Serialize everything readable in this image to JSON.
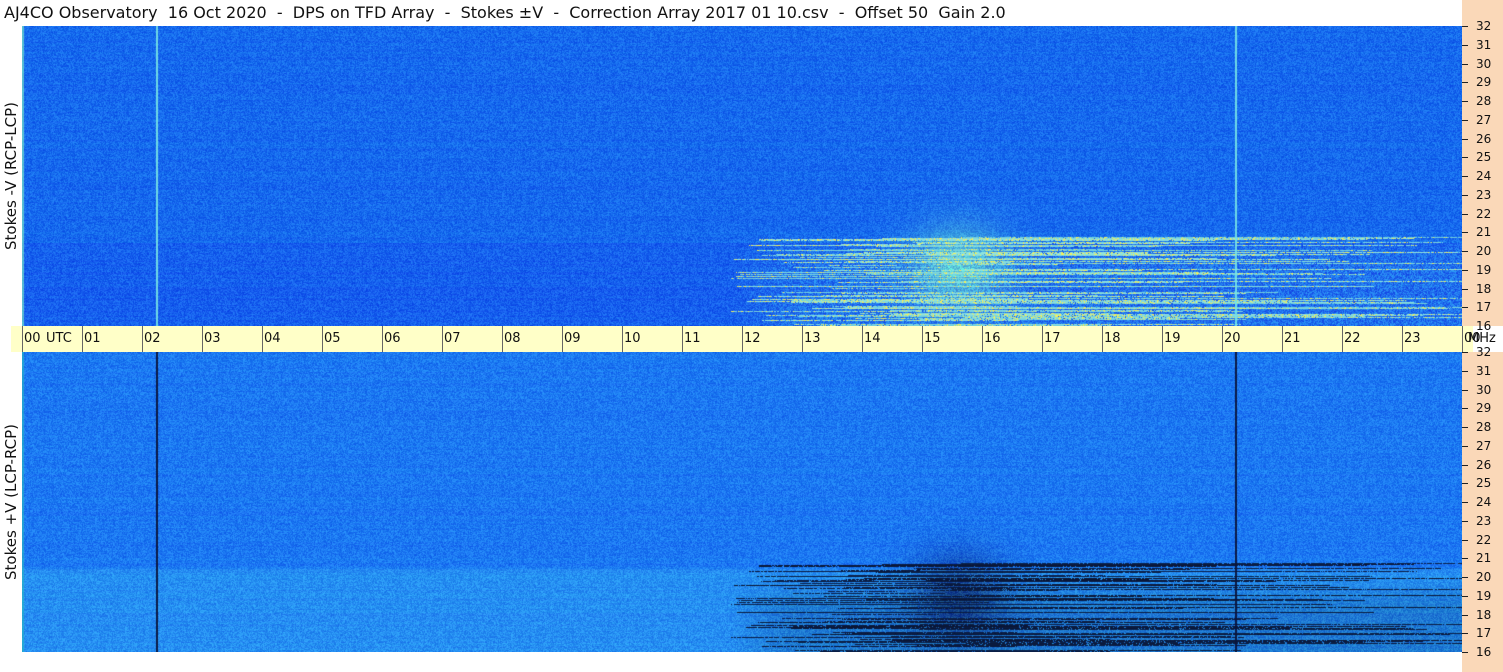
{
  "title": "AJ4CO Observatory  16 Oct 2020  -  DPS on TFD Array  -  Stokes ±V  -  Correction Array 2017 01 10.csv  -  Offset 50  Gain 2.0",
  "panels": [
    {
      "ylabel": "Stokes -V (RCP-LCP)"
    },
    {
      "ylabel": "Stokes +V (LCP-RCP)"
    }
  ],
  "time_labels": [
    "00",
    "01",
    "02",
    "03",
    "04",
    "05",
    "06",
    "07",
    "08",
    "09",
    "10",
    "11",
    "12",
    "13",
    "14",
    "15",
    "16",
    "17",
    "18",
    "19",
    "20",
    "21",
    "22",
    "23",
    "00"
  ],
  "time_unit": "UTC",
  "freq_unit": "MHz",
  "freq_labels": [
    "32",
    "31",
    "30",
    "29",
    "28",
    "27",
    "26",
    "25",
    "24",
    "23",
    "22",
    "21",
    "20",
    "19",
    "18",
    "17",
    "16"
  ],
  "colors": {
    "background": "#1a6cf0",
    "time_bar": "#ffffc8",
    "freq_bar": "#fad8b8",
    "storm_hot": "#f5f060"
  },
  "chart_data": {
    "type": "heatmap",
    "x_axis": {
      "range": [
        "00",
        "00"
      ],
      "ticks": [
        "00",
        "01",
        "02",
        "03",
        "04",
        "05",
        "06",
        "07",
        "08",
        "09",
        "10",
        "11",
        "12",
        "13",
        "14",
        "15",
        "16",
        "17",
        "18",
        "19",
        "20",
        "21",
        "22",
        "23",
        "00"
      ],
      "unit": "UTC"
    },
    "y_axis": {
      "range": [
        16,
        32
      ],
      "ticks": [
        16,
        17,
        18,
        19,
        20,
        21,
        22,
        23,
        24,
        25,
        26,
        27,
        28,
        29,
        30,
        31,
        32
      ],
      "unit": "MHz"
    },
    "panels": [
      "Stokes -V (RCP-LCP)",
      "Stokes +V (LCP-RCP)"
    ],
    "features": [
      {
        "panel": 0,
        "kind": "bright_vertical_line",
        "time_hour": 2.23
      },
      {
        "panel": 0,
        "kind": "bright_vertical_line",
        "time_hour": 20.22
      },
      {
        "panel": 1,
        "kind": "dark_vertical_line",
        "time_hour": 2.23
      },
      {
        "panel": 1,
        "kind": "dark_vertical_line",
        "time_hour": 20.22
      },
      {
        "panel": 0,
        "kind": "emission_region",
        "time_start": 11.8,
        "time_end": 24.0,
        "freq_low": 16,
        "freq_high": 21,
        "polarity": "bright"
      },
      {
        "panel": 1,
        "kind": "emission_region",
        "time_start": 11.8,
        "time_end": 24.0,
        "freq_low": 16,
        "freq_high": 20,
        "polarity": "dark"
      },
      {
        "panel": 0,
        "kind": "hotspot",
        "time_center": 15.6,
        "freq_center": 19.2,
        "polarity": "bright"
      },
      {
        "panel": 1,
        "kind": "hotspot",
        "time_center": 15.6,
        "freq_center": 19.0,
        "polarity": "dark"
      }
    ]
  }
}
